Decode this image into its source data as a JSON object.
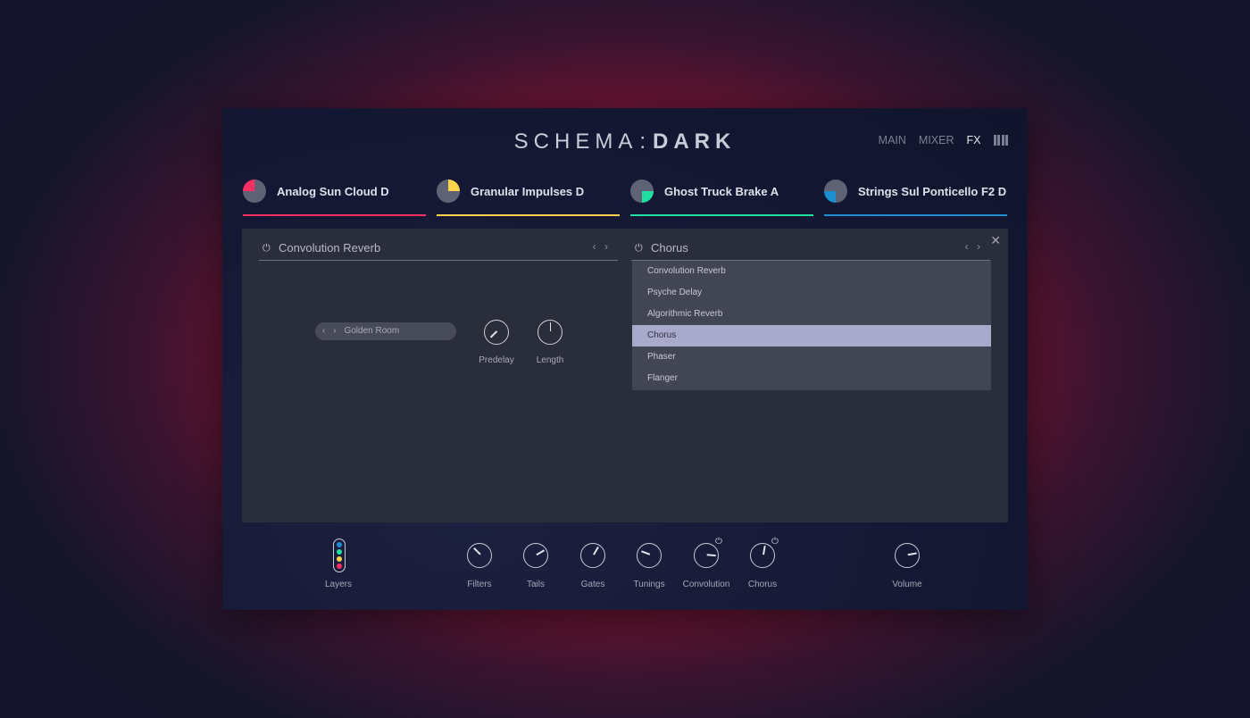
{
  "brand": {
    "left": "SCHEMA",
    "sep": ":",
    "right": "DARK"
  },
  "nav": {
    "main": "MAIN",
    "mixer": "MIXER",
    "fx": "FX"
  },
  "layers": [
    {
      "name": "Analog Sun Cloud D",
      "color": "#ff2e63"
    },
    {
      "name": "Granular Impulses D",
      "color": "#ffd34e"
    },
    {
      "name": "Ghost Truck Brake A",
      "color": "#1fe0a0"
    },
    {
      "name": "Strings Sul Ponticello F2 D",
      "color": "#1c8fd0"
    }
  ],
  "fx": {
    "slot1": {
      "title": "Convolution Reverb",
      "power": "⏻",
      "arrows": "‹ ›"
    },
    "slot2": {
      "title": "Chorus",
      "power": "⏻",
      "arrows": "‹ ›"
    },
    "preset": {
      "value": "Golden Room",
      "arrows": "‹ ›"
    },
    "knobs": [
      {
        "label": "Predelay"
      },
      {
        "label": "Length"
      }
    ],
    "dropdown": {
      "options": [
        "Convolution Reverb",
        "Psyche Delay",
        "Algorithmic Reverb",
        "Chorus",
        "Phaser",
        "Flanger"
      ],
      "selected": "Chorus"
    },
    "close": "✕"
  },
  "bottom": {
    "layers_label": "Layers",
    "knobs": [
      {
        "label": "Filters"
      },
      {
        "label": "Tails"
      },
      {
        "label": "Gates"
      },
      {
        "label": "Tunings"
      },
      {
        "label": "Convolution",
        "power": "⏻"
      },
      {
        "label": "Chorus",
        "power": "⏻"
      },
      {
        "label": "Volume"
      }
    ]
  }
}
